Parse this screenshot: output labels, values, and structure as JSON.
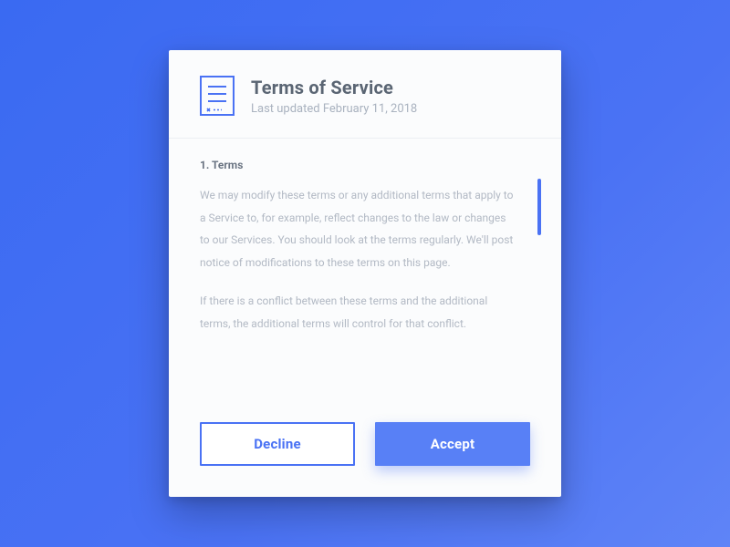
{
  "header": {
    "title": "Terms of Service",
    "subtitle": "Last updated February 11, 2018"
  },
  "content": {
    "section_heading": "1. Terms",
    "paragraph1": "We may modify these terms or any additional terms that apply to a Service to, for example, reflect changes to the law or changes to our Services. You should look at the terms regularly. We'll post notice of modifications to these terms on this page.",
    "paragraph2": "If there is a conflict between these terms and the additional terms, the additional terms will control for that conflict."
  },
  "buttons": {
    "decline": "Decline",
    "accept": "Accept"
  },
  "colors": {
    "accent": "#4a72f4"
  }
}
